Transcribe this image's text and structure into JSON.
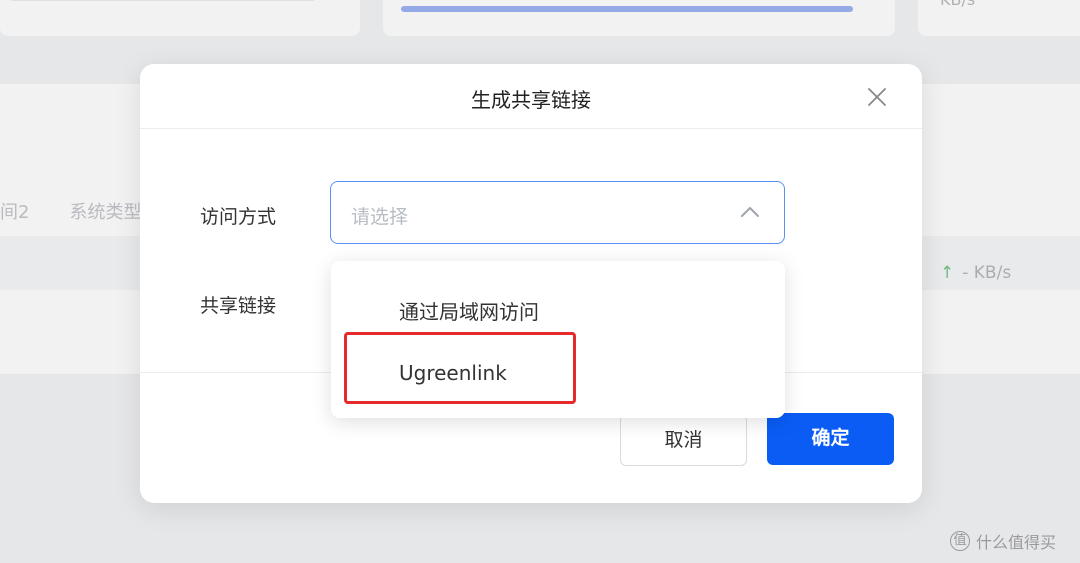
{
  "background": {
    "top_right_text": "KB/s",
    "tab_labels": [
      "间2",
      "系统类型"
    ],
    "speed_icon": "arrow-up-icon",
    "speed_text": "- KB/s"
  },
  "modal": {
    "title": "生成共享链接",
    "close_icon": "close-icon",
    "access_label": "访问方式",
    "select_placeholder": "请选择",
    "link_label": "共享链接",
    "cancel_label": "取消",
    "confirm_label": "确定"
  },
  "dropdown": {
    "options": [
      {
        "label": "通过局域网访问"
      },
      {
        "label": "Ugreenlink"
      }
    ],
    "highlighted_option": "Ugreenlink"
  },
  "watermark": {
    "logo_glyph": "值",
    "text": "什么值得买"
  },
  "colors": {
    "primary": "#0a5cf5",
    "focus_border": "#5b8ff5",
    "highlight_red": "#e42a2a"
  }
}
